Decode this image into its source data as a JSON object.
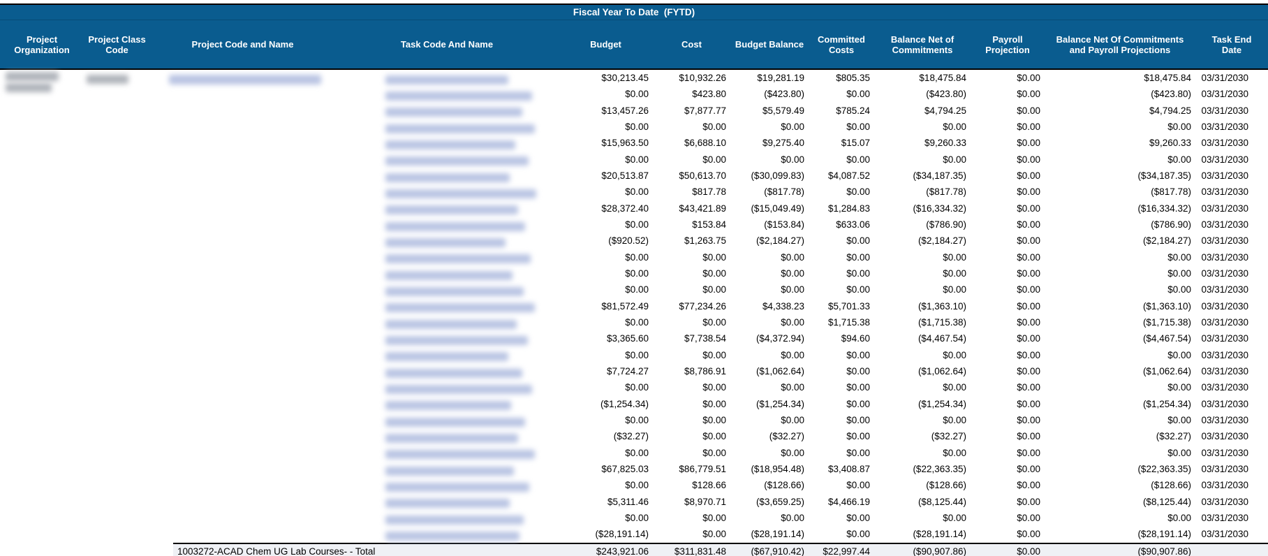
{
  "banner": "Fiscal Year To Date  (FYTD)",
  "columns": {
    "project_organization": "Project Organization",
    "project_class_code": "Project Class Code",
    "project_code_and_name": "Project Code and Name",
    "task_code_and_name": "Task Code And Name",
    "budget": "Budget",
    "cost": "Cost",
    "budget_balance": "Budget Balance",
    "committed_costs": "Committed Costs",
    "balance_net_of_commitments": "Balance Net of Commitments",
    "payroll_projection": "Payroll Projection",
    "balance_net_of_commitments_and_payroll_projections": "Balance Net Of Commitments and Payroll Projections",
    "task_end_date": "Task End Date"
  },
  "redaction": {
    "project_organization": "blurred",
    "project_class_code": "blurred",
    "project_code_and_name": "blurred-link",
    "task_code_and_name": "blurred-link"
  },
  "table": {
    "rows": [
      {
        "cells": [
          "$30,213.45",
          "$10,932.26",
          "$19,281.19",
          "$805.35",
          "$18,475.84",
          "$0.00",
          "$18,475.84",
          "03/31/2030"
        ]
      },
      {
        "cells": [
          "$0.00",
          "$423.80",
          "($423.80)",
          "$0.00",
          "($423.80)",
          "$0.00",
          "($423.80)",
          "03/31/2030"
        ]
      },
      {
        "cells": [
          "$13,457.26",
          "$7,877.77",
          "$5,579.49",
          "$785.24",
          "$4,794.25",
          "$0.00",
          "$4,794.25",
          "03/31/2030"
        ]
      },
      {
        "cells": [
          "$0.00",
          "$0.00",
          "$0.00",
          "$0.00",
          "$0.00",
          "$0.00",
          "$0.00",
          "03/31/2030"
        ]
      },
      {
        "cells": [
          "$15,963.50",
          "$6,688.10",
          "$9,275.40",
          "$15.07",
          "$9,260.33",
          "$0.00",
          "$9,260.33",
          "03/31/2030"
        ]
      },
      {
        "cells": [
          "$0.00",
          "$0.00",
          "$0.00",
          "$0.00",
          "$0.00",
          "$0.00",
          "$0.00",
          "03/31/2030"
        ]
      },
      {
        "cells": [
          "$20,513.87",
          "$50,613.70",
          "($30,099.83)",
          "$4,087.52",
          "($34,187.35)",
          "$0.00",
          "($34,187.35)",
          "03/31/2030"
        ]
      },
      {
        "cells": [
          "$0.00",
          "$817.78",
          "($817.78)",
          "$0.00",
          "($817.78)",
          "$0.00",
          "($817.78)",
          "03/31/2030"
        ]
      },
      {
        "cells": [
          "$28,372.40",
          "$43,421.89",
          "($15,049.49)",
          "$1,284.83",
          "($16,334.32)",
          "$0.00",
          "($16,334.32)",
          "03/31/2030"
        ]
      },
      {
        "cells": [
          "$0.00",
          "$153.84",
          "($153.84)",
          "$633.06",
          "($786.90)",
          "$0.00",
          "($786.90)",
          "03/31/2030"
        ]
      },
      {
        "cells": [
          "($920.52)",
          "$1,263.75",
          "($2,184.27)",
          "$0.00",
          "($2,184.27)",
          "$0.00",
          "($2,184.27)",
          "03/31/2030"
        ]
      },
      {
        "cells": [
          "$0.00",
          "$0.00",
          "$0.00",
          "$0.00",
          "$0.00",
          "$0.00",
          "$0.00",
          "03/31/2030"
        ]
      },
      {
        "cells": [
          "$0.00",
          "$0.00",
          "$0.00",
          "$0.00",
          "$0.00",
          "$0.00",
          "$0.00",
          "03/31/2030"
        ]
      },
      {
        "cells": [
          "$0.00",
          "$0.00",
          "$0.00",
          "$0.00",
          "$0.00",
          "$0.00",
          "$0.00",
          "03/31/2030"
        ]
      },
      {
        "cells": [
          "$81,572.49",
          "$77,234.26",
          "$4,338.23",
          "$5,701.33",
          "($1,363.10)",
          "$0.00",
          "($1,363.10)",
          "03/31/2030"
        ]
      },
      {
        "cells": [
          "$0.00",
          "$0.00",
          "$0.00",
          "$1,715.38",
          "($1,715.38)",
          "$0.00",
          "($1,715.38)",
          "03/31/2030"
        ]
      },
      {
        "cells": [
          "$3,365.60",
          "$7,738.54",
          "($4,372.94)",
          "$94.60",
          "($4,467.54)",
          "$0.00",
          "($4,467.54)",
          "03/31/2030"
        ]
      },
      {
        "cells": [
          "$0.00",
          "$0.00",
          "$0.00",
          "$0.00",
          "$0.00",
          "$0.00",
          "$0.00",
          "03/31/2030"
        ]
      },
      {
        "cells": [
          "$7,724.27",
          "$8,786.91",
          "($1,062.64)",
          "$0.00",
          "($1,062.64)",
          "$0.00",
          "($1,062.64)",
          "03/31/2030"
        ]
      },
      {
        "cells": [
          "$0.00",
          "$0.00",
          "$0.00",
          "$0.00",
          "$0.00",
          "$0.00",
          "$0.00",
          "03/31/2030"
        ]
      },
      {
        "cells": [
          "($1,254.34)",
          "$0.00",
          "($1,254.34)",
          "$0.00",
          "($1,254.34)",
          "$0.00",
          "($1,254.34)",
          "03/31/2030"
        ]
      },
      {
        "cells": [
          "$0.00",
          "$0.00",
          "$0.00",
          "$0.00",
          "$0.00",
          "$0.00",
          "$0.00",
          "03/31/2030"
        ]
      },
      {
        "cells": [
          "($32.27)",
          "$0.00",
          "($32.27)",
          "$0.00",
          "($32.27)",
          "$0.00",
          "($32.27)",
          "03/31/2030"
        ]
      },
      {
        "cells": [
          "$0.00",
          "$0.00",
          "$0.00",
          "$0.00",
          "$0.00",
          "$0.00",
          "$0.00",
          "03/31/2030"
        ]
      },
      {
        "cells": [
          "$67,825.03",
          "$86,779.51",
          "($18,954.48)",
          "$3,408.87",
          "($22,363.35)",
          "$0.00",
          "($22,363.35)",
          "03/31/2030"
        ]
      },
      {
        "cells": [
          "$0.00",
          "$128.66",
          "($128.66)",
          "$0.00",
          "($128.66)",
          "$0.00",
          "($128.66)",
          "03/31/2030"
        ]
      },
      {
        "cells": [
          "$5,311.46",
          "$8,970.71",
          "($3,659.25)",
          "$4,466.19",
          "($8,125.44)",
          "$0.00",
          "($8,125.44)",
          "03/31/2030"
        ]
      },
      {
        "cells": [
          "$0.00",
          "$0.00",
          "$0.00",
          "$0.00",
          "$0.00",
          "$0.00",
          "$0.00",
          "03/31/2030"
        ]
      },
      {
        "cells": [
          "($28,191.14)",
          "$0.00",
          "($28,191.14)",
          "$0.00",
          "($28,191.14)",
          "$0.00",
          "($28,191.14)",
          "03/31/2030"
        ]
      }
    ],
    "total": {
      "label": "1003272-ACAD Chem UG Lab Courses- - Total",
      "cells": [
        "$243,921.06",
        "$311,831.48",
        "($67,910.42)",
        "$22,997.44",
        "($90,907.86)",
        "$0.00",
        "($90,907.86)",
        ""
      ]
    }
  },
  "colors": {
    "header_background": "#0a5c8f",
    "header_text": "#ffffff",
    "border_black": "#000000",
    "total_row_background": "#eff1f5",
    "redacted_link": "#b9c4e3",
    "redacted_text": "#afb3ba"
  }
}
